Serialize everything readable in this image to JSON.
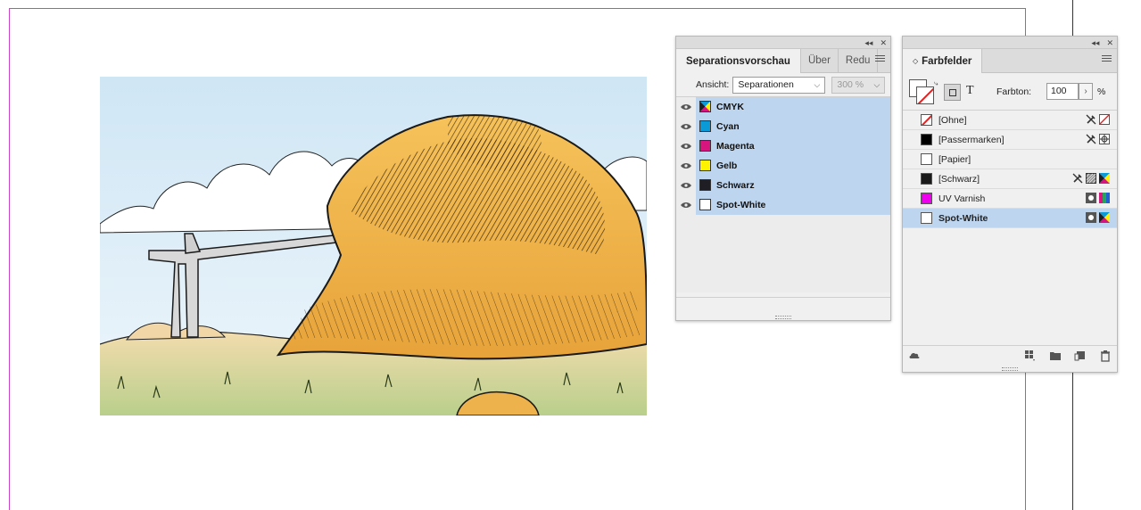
{
  "separations_panel": {
    "tabs": [
      {
        "label": "Separationsvorschau",
        "active": true
      },
      {
        "label": "Über",
        "active": false
      },
      {
        "label": "Redu",
        "active": false
      }
    ],
    "view_label": "Ansicht:",
    "view_value": "Separationen",
    "zoom_value": "300 %",
    "separations": [
      {
        "name": "CMYK",
        "swatch": "cmyk"
      },
      {
        "name": "Cyan",
        "swatch": "#0a9ad8"
      },
      {
        "name": "Magenta",
        "swatch": "#d8157f"
      },
      {
        "name": "Gelb",
        "swatch": "#fff200"
      },
      {
        "name": "Schwarz",
        "swatch": "#1e1e24"
      },
      {
        "name": "Spot-White",
        "swatch": "#ffffff"
      }
    ]
  },
  "swatches_panel": {
    "tab_label": "Farbfelder",
    "tint_label": "Farbton:",
    "tint_value": "100",
    "tint_unit": "%",
    "text_toggle_label": "T",
    "swatches": [
      {
        "name": "[Ohne]",
        "color": "none",
        "selected": false,
        "icons": [
          "no-edit-icon",
          "none-color-icon"
        ]
      },
      {
        "name": "[Passermarken]",
        "color": "#000000",
        "selected": false,
        "icons": [
          "no-edit-icon",
          "registration-icon"
        ]
      },
      {
        "name": "[Papier]",
        "color": "#ffffff",
        "selected": false,
        "icons": []
      },
      {
        "name": "[Schwarz]",
        "color": "#1a1a1a",
        "selected": false,
        "icons": [
          "no-edit-icon",
          "process-icon",
          "cmyk-icon"
        ]
      },
      {
        "name": "UV Varnish",
        "color": "#ee00ee",
        "selected": false,
        "icons": [
          "spot-icon",
          "spot-lab-icon"
        ]
      },
      {
        "name": "Spot-White",
        "color": "#ffffff",
        "selected": true,
        "icons": [
          "spot-icon",
          "cmyk-icon"
        ]
      }
    ]
  },
  "colors": {
    "selection": "#bdd5ef",
    "page_guide": "#cc44cc"
  }
}
